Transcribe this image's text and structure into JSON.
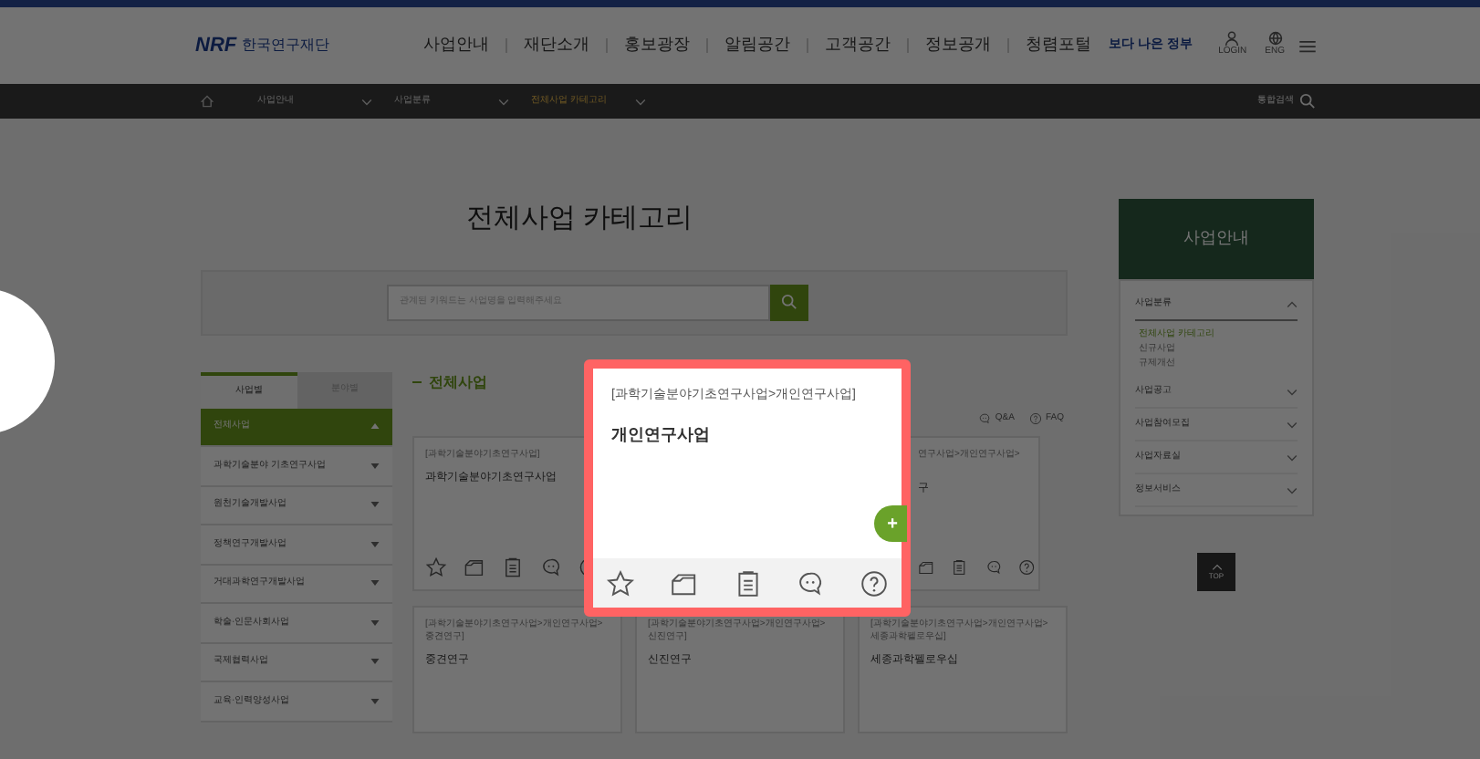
{
  "header": {
    "logo_mark": "NRF",
    "logo_text": "한국연구재단",
    "nav": [
      "사업안내",
      "재단소개",
      "홍보광장",
      "알림공간",
      "고객공간",
      "정보공개",
      "청렴포털"
    ],
    "badge": "보다 나은 정부",
    "login": "LOGIN",
    "lang": "ENG"
  },
  "breadcrumb": {
    "items": [
      {
        "label": "사업안내",
        "selected": false
      },
      {
        "label": "사업분류",
        "selected": false
      },
      {
        "label": "전체사업 카테고리",
        "selected": true
      }
    ],
    "search": "통합검색"
  },
  "title": "전체사업 카테고리",
  "search": {
    "placeholder": "관계된 키워드는 사업명을 입력해주세요"
  },
  "left_tabs": [
    {
      "label": "사업별",
      "selected": true
    },
    {
      "label": "분야별",
      "selected": false
    }
  ],
  "left_menu": [
    {
      "label": "전체사업",
      "selected": true
    },
    {
      "label": "과학기술분야 기초연구사업",
      "selected": false
    },
    {
      "label": "원천기술개발사업",
      "selected": false
    },
    {
      "label": "정책연구개발사업",
      "selected": false
    },
    {
      "label": "거대과학연구개발사업",
      "selected": false
    },
    {
      "label": "학술·인문사회사업",
      "selected": false
    },
    {
      "label": "국제협력사업",
      "selected": false
    },
    {
      "label": "교육·인력양성사업",
      "selected": false
    }
  ],
  "section": {
    "title": "전체사업",
    "links": [
      "Q&A",
      "FAQ"
    ]
  },
  "cards_row1": [
    {
      "category": "[과학기술분야기초연구사업]",
      "title": "과학기술분야기초연구사업"
    },
    {
      "category": "연구사업>개인연구사업>",
      "title": "구"
    }
  ],
  "cards_row2": [
    {
      "category": "[과학기술분야기초연구사업>개인연구사업>중견연구]",
      "title": "중견연구"
    },
    {
      "category": "[과학기술분야기초연구사업>개인연구사업>신진연구]",
      "title": "신진연구"
    },
    {
      "category": "[과학기술분야기초연구사업>개인연구사업>세종과학펠로우십]",
      "title": "세종과학펠로우십"
    }
  ],
  "highlighted_card": {
    "category": "[과학기술분야기초연구사업>개인연구사업]",
    "title": "개인연구사업",
    "add": "+"
  },
  "right_panel": {
    "title": "사업안내",
    "items": [
      {
        "label": "사업분류",
        "expanded": true,
        "children": [
          {
            "label": "전체사업 카테고리",
            "selected": true
          },
          {
            "label": "신규사업",
            "selected": false
          },
          {
            "label": "규제개선",
            "selected": false
          }
        ]
      },
      {
        "label": "사업공고",
        "expanded": false
      },
      {
        "label": "사업참여모집",
        "expanded": false
      },
      {
        "label": "사업자료실",
        "expanded": false
      },
      {
        "label": "정보서비스",
        "expanded": false
      }
    ],
    "top": "TOP"
  }
}
